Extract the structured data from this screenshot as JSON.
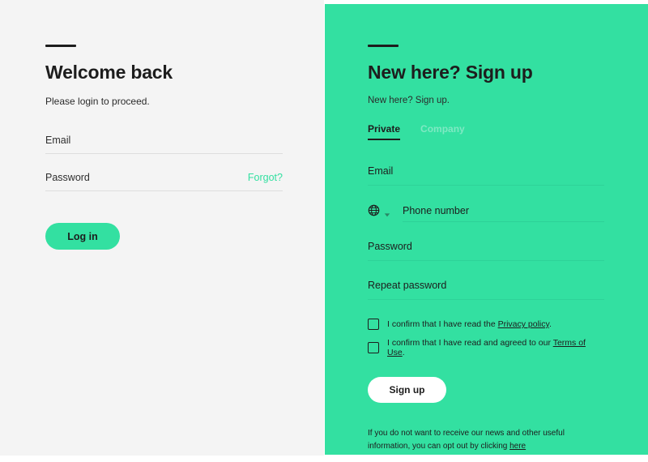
{
  "theme": {
    "accent_green": "#33e0a1",
    "panel_left_bg": "#f4f4f4",
    "panel_right_bg": "#33e0a1",
    "text_dark": "#1d1d1d",
    "muted_tab": "#7fe9c3",
    "input_line_left": "#dedede",
    "input_line_right": "#2ed298"
  },
  "login": {
    "heading": "Welcome back",
    "subtext": "Please login to proceed.",
    "email": {
      "label": "Email",
      "value": ""
    },
    "password": {
      "label": "Password",
      "value": "",
      "forgot_label": "Forgot?"
    },
    "submit_label": "Log in"
  },
  "signup": {
    "heading": "New here? Sign up",
    "subtext": "New here? Sign up.",
    "tabs": [
      {
        "label": "Private",
        "active": true
      },
      {
        "label": "Company",
        "active": false
      }
    ],
    "fields": {
      "email": {
        "label": "Email",
        "value": ""
      },
      "phone": {
        "label": "Phone number",
        "value": "",
        "icon": "globe-icon",
        "dropdown_icon": "chevron-down-icon"
      },
      "password": {
        "label": "Password",
        "value": ""
      },
      "repeat_password": {
        "label": "Repeat password",
        "value": ""
      }
    },
    "consents": [
      {
        "checked": false,
        "text_before": "I confirm that I have read the ",
        "link": "Privacy policy",
        "text_after": "."
      },
      {
        "checked": false,
        "text_before": "I confirm that I have read and agreed to our ",
        "link": "Terms of Use",
        "text_after": "."
      }
    ],
    "submit_label": "Sign up",
    "optout": {
      "text_before": "If you do not want to receive our news and other useful information, you can opt out by clicking ",
      "link": "here",
      "text_after": ""
    }
  }
}
